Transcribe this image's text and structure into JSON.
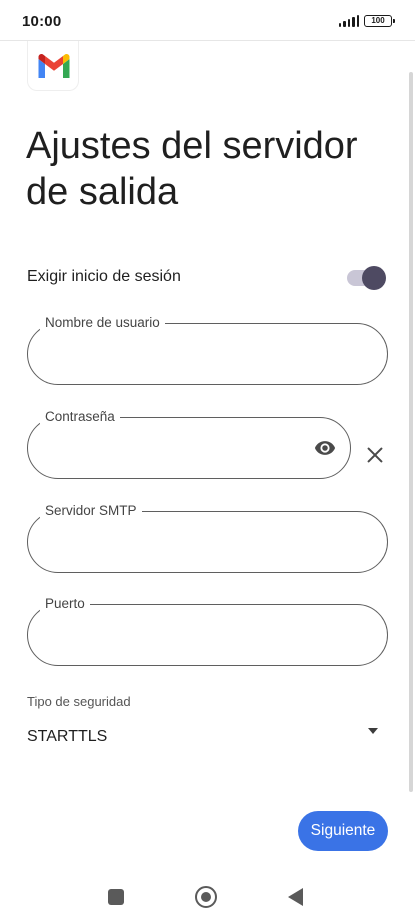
{
  "status_bar": {
    "time": "10:00",
    "battery": "100",
    "icons": [
      "signal-icon",
      "battery-icon"
    ]
  },
  "app": {
    "logo": "gmail-logo"
  },
  "page": {
    "title": "Ajustes del servidor de salida"
  },
  "require_login": {
    "label": "Exigir inicio de sesión",
    "enabled": true
  },
  "fields": {
    "username": {
      "label": "Nombre de usuario",
      "value": ""
    },
    "password": {
      "label": "Contraseña",
      "value": ""
    },
    "smtp_server": {
      "label": "Servidor SMTP",
      "value": ""
    },
    "port": {
      "label": "Puerto",
      "value": ""
    }
  },
  "security": {
    "label": "Tipo de seguridad",
    "selected": "STARTTLS"
  },
  "actions": {
    "next_label": "Siguiente"
  },
  "colors": {
    "accent": "#3a73e6",
    "toggle_thumb": "#4e4a62",
    "toggle_track": "#c9c6d6",
    "gmail_red": "#ea4335",
    "gmail_blue": "#4285f4",
    "gmail_green": "#34a853",
    "gmail_yellow": "#fbbc04"
  },
  "nav_bar": {
    "icons": [
      "recents-icon",
      "home-icon",
      "back-icon"
    ]
  }
}
